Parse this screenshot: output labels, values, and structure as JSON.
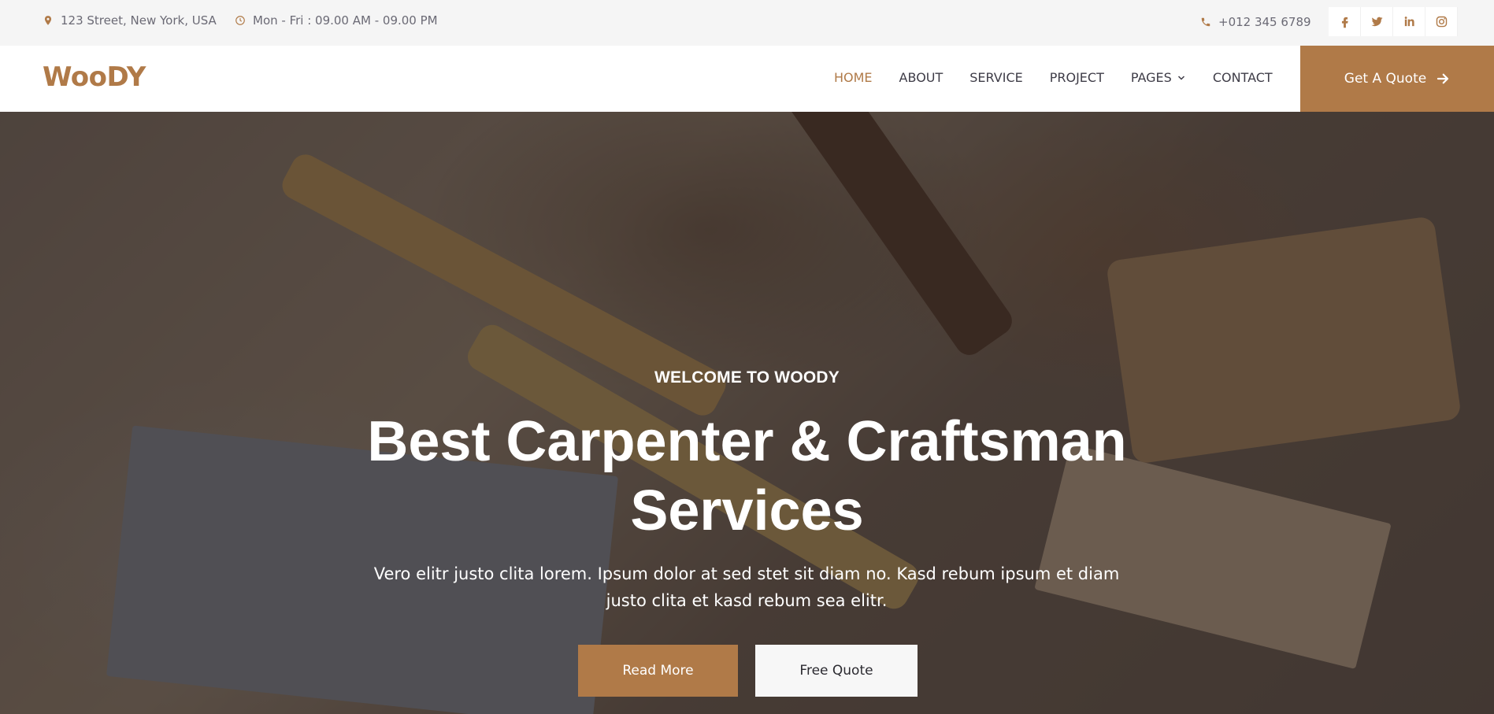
{
  "topbar": {
    "address": "123 Street, New York, USA",
    "hours": "Mon - Fri : 09.00 AM - 09.00 PM",
    "phone": "+012 345 6789",
    "socials": [
      "facebook-icon",
      "twitter-icon",
      "linkedin-icon",
      "instagram-icon"
    ]
  },
  "brand": {
    "logo": "WooDY",
    "accent": "#b07a48"
  },
  "nav": {
    "items": [
      {
        "label": "HOME",
        "active": true
      },
      {
        "label": "ABOUT"
      },
      {
        "label": "SERVICE"
      },
      {
        "label": "PROJECT"
      },
      {
        "label": "PAGES",
        "dropdown": true
      },
      {
        "label": "CONTACT"
      }
    ],
    "cta": "Get A Quote"
  },
  "hero": {
    "eyebrow": "WELCOME TO WOODY",
    "title_line1": "Best Carpenter & Craftsman",
    "title_line2": "Services",
    "description_line1": "Vero elitr justo clita lorem. Ipsum dolor at sed stet sit diam no. Kasd rebum ipsum et diam",
    "description_line2": "justo clita et kasd rebum sea elitr.",
    "primary_button": "Read More",
    "secondary_button": "Free Quote"
  }
}
